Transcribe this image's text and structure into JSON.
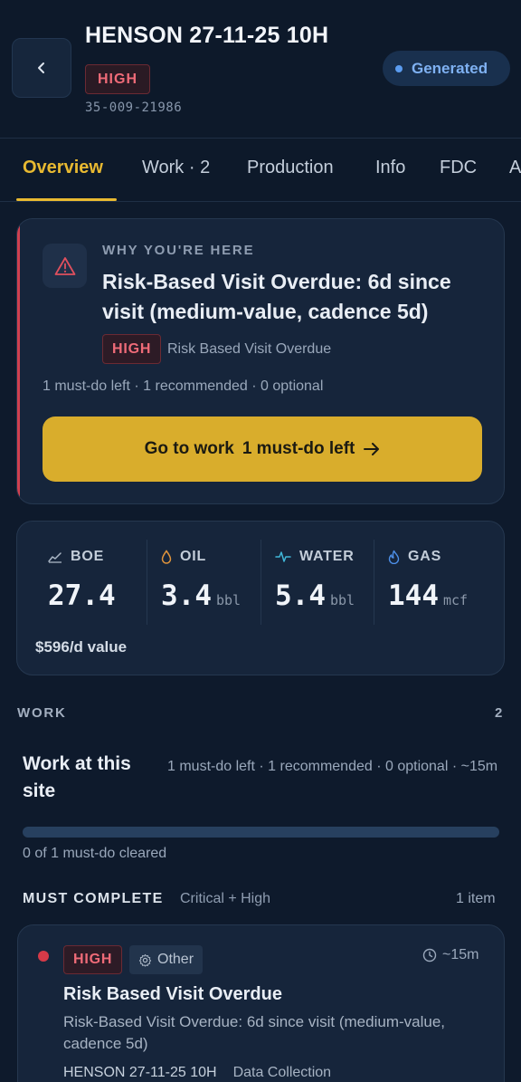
{
  "header": {
    "title": "HENSON 27-11-25 10H",
    "priority": "HIGH",
    "api_number": "35-009-21986",
    "status": "Generated"
  },
  "tabs": [
    "Overview",
    "Work · 2",
    "Production",
    "Info",
    "FDC",
    "A"
  ],
  "why": {
    "label": "WHY YOU'RE HERE",
    "title": "Risk-Based Visit Overdue: 6d since visit (medium-value, cadence 5d)",
    "priority": "HIGH",
    "reason": "Risk Based Visit Overdue",
    "counts": "1 must-do left · 1 recommended · 0 optional",
    "button_main": "Go to work",
    "button_sub": "1 must-do left"
  },
  "metrics": {
    "items": [
      {
        "label": "BOE",
        "value": "27.4",
        "unit": "",
        "icon": "trend-line-icon"
      },
      {
        "label": "OIL",
        "value": "3.4",
        "unit": "bbl",
        "icon": "drop-icon"
      },
      {
        "label": "WATER",
        "value": "5.4",
        "unit": "bbl",
        "icon": "pulse-icon"
      },
      {
        "label": "GAS",
        "value": "144",
        "unit": "mcf",
        "icon": "flame-icon"
      }
    ],
    "value_line": "$596/d value"
  },
  "work": {
    "section_label": "WORK",
    "section_count": "2",
    "title": "Work at this site",
    "summary": "1 must-do left · 1 recommended · 0 optional · ~15m",
    "progress_fraction": 0,
    "cleared": "0 of 1 must-do cleared",
    "must_label": "MUST COMPLETE",
    "must_sub": "Critical + High",
    "must_count": "1 item"
  },
  "item": {
    "priority": "HIGH",
    "category": "Other",
    "time": "~15m",
    "title": "Risk Based Visit Overdue",
    "description": "Risk-Based Visit Overdue: 6d since visit (medium-value, cadence 5d)",
    "site": "HENSON 27-11-25 10H",
    "type": "Data Collection"
  },
  "colors": {
    "background": "#0e1a2c",
    "accent": "#d9ad2c",
    "high": "#ef6b78",
    "generated": "#7fb1f2"
  }
}
